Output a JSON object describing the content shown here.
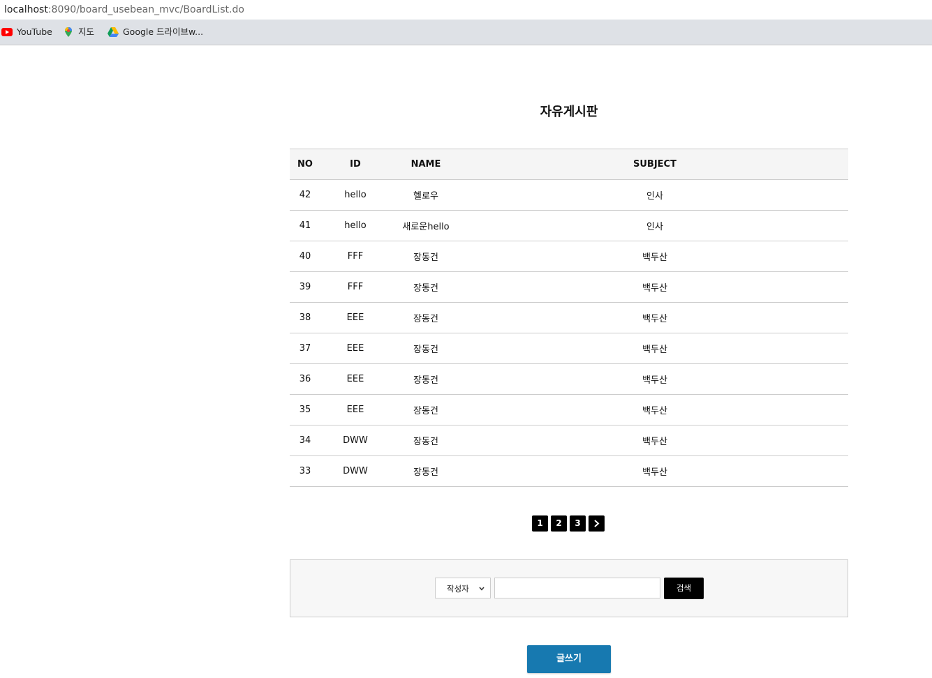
{
  "browser": {
    "url_host": "localhost",
    "url_rest": ":8090/board_usebean_mvc/BoardList.do",
    "bookmarks": [
      {
        "label": "YouTube",
        "icon": "youtube-icon"
      },
      {
        "label": "지도",
        "icon": "maps-icon"
      },
      {
        "label": "Google 드라이브w...",
        "icon": "google-drive-icon"
      }
    ]
  },
  "board": {
    "title": "자유게시판",
    "columns": {
      "no": "NO",
      "id": "ID",
      "name": "NAME",
      "subject": "SUBJECT"
    },
    "rows": [
      {
        "no": "42",
        "id": "hello",
        "name": "헬로우",
        "subject": "인사"
      },
      {
        "no": "41",
        "id": "hello",
        "name": "새로운hello",
        "subject": "인사"
      },
      {
        "no": "40",
        "id": "FFF",
        "name": "장동건",
        "subject": "백두산"
      },
      {
        "no": "39",
        "id": "FFF",
        "name": "장동건",
        "subject": "백두산"
      },
      {
        "no": "38",
        "id": "EEE",
        "name": "장동건",
        "subject": "백두산"
      },
      {
        "no": "37",
        "id": "EEE",
        "name": "장동건",
        "subject": "백두산"
      },
      {
        "no": "36",
        "id": "EEE",
        "name": "장동건",
        "subject": "백두산"
      },
      {
        "no": "35",
        "id": "EEE",
        "name": "장동건",
        "subject": "백두산"
      },
      {
        "no": "34",
        "id": "DWW",
        "name": "장동건",
        "subject": "백두산"
      },
      {
        "no": "33",
        "id": "DWW",
        "name": "장동건",
        "subject": "백두산"
      }
    ]
  },
  "pagination": {
    "pages": [
      "1",
      "2",
      "3"
    ],
    "next_icon": "chevron-right-icon"
  },
  "search": {
    "selected_option": "작성자",
    "value": "",
    "button_label": "검색"
  },
  "write_button_label": "글쓰기",
  "colors": {
    "accent": "#1779b0",
    "dark": "#000000",
    "header_bg": "#f5f5f5"
  }
}
